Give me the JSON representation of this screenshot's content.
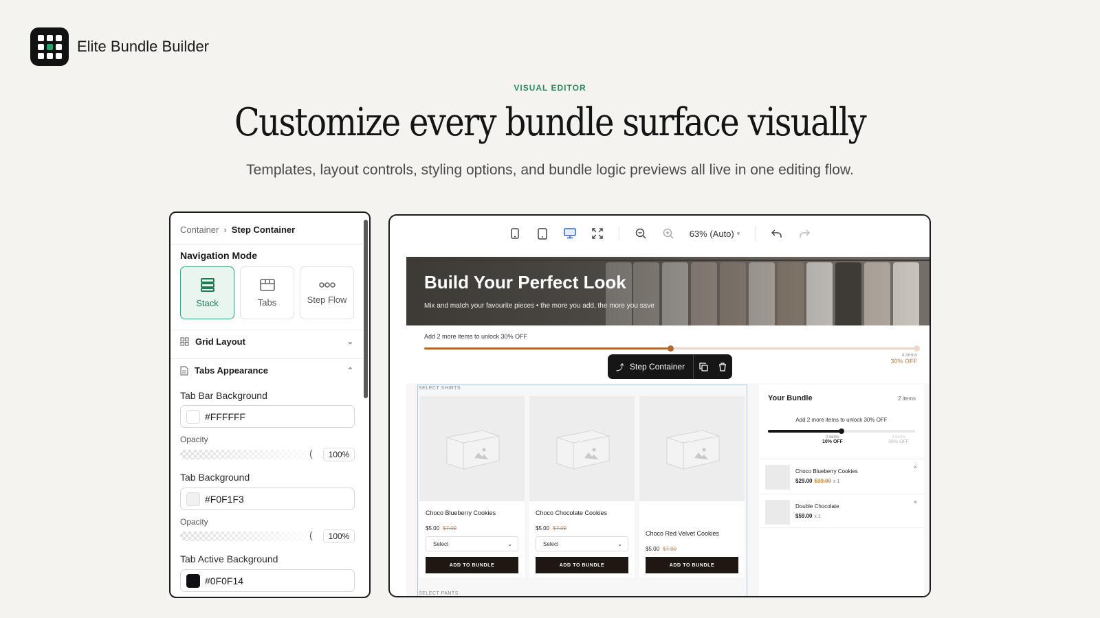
{
  "brand": {
    "name": "Elite Bundle Builder"
  },
  "hero": {
    "eyebrow": "VISUAL EDITOR",
    "headline": "Customize every bundle surface visually",
    "subhead": "Templates, layout controls, styling options, and bundle logic previews all live in one editing flow."
  },
  "editor": {
    "breadcrumb": {
      "parent": "Container",
      "current": "Step Container"
    },
    "navigation_mode": {
      "title": "Navigation Mode",
      "options": [
        {
          "label": "Stack",
          "icon": "stack-icon",
          "active": true
        },
        {
          "label": "Tabs",
          "icon": "tabs-icon",
          "active": false
        },
        {
          "label": "Step Flow",
          "icon": "step-flow-icon",
          "active": false
        }
      ]
    },
    "sections": {
      "grid_layout": "Grid Layout",
      "tabs_appearance": "Tabs Appearance"
    },
    "fields": {
      "tab_bar_background": {
        "label": "Tab Bar Background",
        "value": "#FFFFFF",
        "opacity_label": "Opacity",
        "opacity": "100%"
      },
      "tab_background": {
        "label": "Tab Background",
        "value": "#F0F1F3",
        "opacity_label": "Opacity",
        "opacity": "100%"
      },
      "tab_active_background": {
        "label": "Tab Active Background",
        "value": "#0F0F14"
      }
    }
  },
  "preview": {
    "zoom": "63% (Auto)",
    "banner": {
      "title": "Build Your Perfect Look",
      "subtitle": "Mix and match your favourite pieces • the more you add, the more you save"
    },
    "progress": {
      "message": "Add 2 more items to unlock 30% OFF",
      "fill_fraction": 0.5,
      "end_items": "4 items",
      "end_discount": "30% OFF"
    },
    "step_chip": {
      "label": "Step Container"
    },
    "section_labels": {
      "shirts": "SELECT SHIRTS",
      "pants": "SELECT PANTS"
    },
    "products": [
      {
        "name": "Choco Blueberry Cookies",
        "price": "$5.00",
        "compare": "$7.00",
        "select": "Select",
        "button": "ADD TO BUNDLE"
      },
      {
        "name": "Choco Chocolate Cookies",
        "price": "$5.00",
        "compare": "$7.00",
        "select": "Select",
        "button": "ADD TO BUNDLE"
      },
      {
        "name": "Choco Red Velvet Cookies",
        "price": "$5.00",
        "compare": "$7.00",
        "button": "ADD TO BUNDLE"
      }
    ],
    "bundle": {
      "title": "Your Bundle",
      "count": "2 items",
      "message": "Add 2 more items to unlock 30% OFF",
      "fill_fraction": 0.5,
      "ticks": [
        {
          "items": "2 items",
          "discount": "10% OFF"
        },
        {
          "items": "4 items",
          "discount": "30% OFF"
        }
      ],
      "items": [
        {
          "name": "Choco Blueberry Cookies",
          "price": "$29.00",
          "compare": "$39.00",
          "qty": "x 1"
        },
        {
          "name": "Double Chocolate",
          "price": "$59.00",
          "qty": "x 1"
        }
      ]
    }
  },
  "colors": {
    "accent": "#2F9E6E",
    "progress": "#B06A2E",
    "dark": "#161616"
  }
}
